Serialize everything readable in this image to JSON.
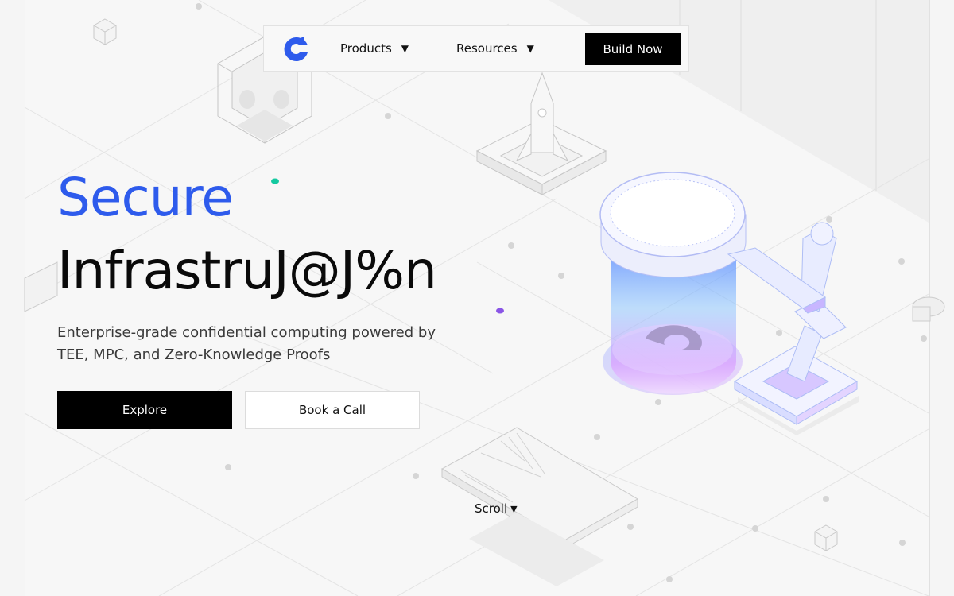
{
  "nav": {
    "products_label": "Products",
    "resources_label": "Resources",
    "build_label": "Build Now",
    "caret": "▼"
  },
  "hero": {
    "line1": "Secure",
    "line2": "InfrastruJ@J%n",
    "subtitle_1": "Enterprise-grade confidential computing powered by",
    "subtitle_2": "TEE, MPC, and Zero-Knowledge Proofs"
  },
  "cta": {
    "explore_label": "Explore",
    "call_label": "Book a Call"
  },
  "scroll": {
    "label": "Scroll",
    "caret": "▼"
  },
  "colors": {
    "accent": "#2e5bec",
    "button_dark": "#000000",
    "dot_teal": "#14c9a0",
    "dot_purple": "#8a55e6"
  },
  "icons": {
    "logo": "c-logo-icon",
    "caret": "chevron-down-icon"
  }
}
